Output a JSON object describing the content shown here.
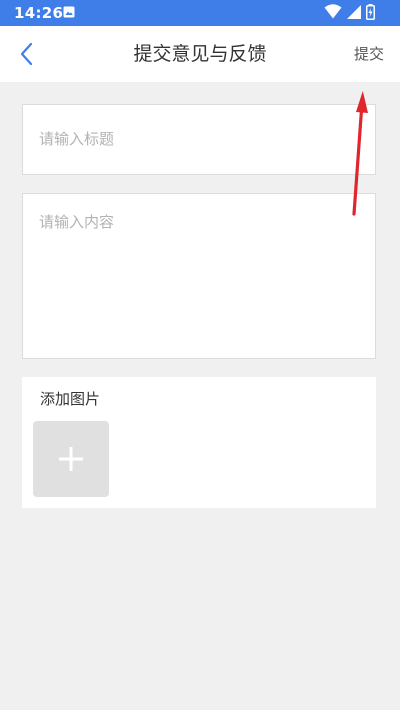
{
  "status_bar": {
    "time": "14:26",
    "icons": [
      "notification-icon",
      "wifi-icon",
      "signal-icon",
      "battery-icon"
    ]
  },
  "header": {
    "back_icon": "chevron-left-icon",
    "title": "提交意见与反馈",
    "submit_label": "提交"
  },
  "form": {
    "title_placeholder": "请输入标题",
    "title_value": "",
    "content_placeholder": "请输入内容",
    "content_value": "",
    "add_image_label": "添加图片",
    "add_image_icon": "plus-icon"
  },
  "colors": {
    "status_bar": "#3f7ee8",
    "accent": "#3f7ee8",
    "page_background": "#f0f0f0",
    "annotation_arrow": "#e0262c"
  }
}
